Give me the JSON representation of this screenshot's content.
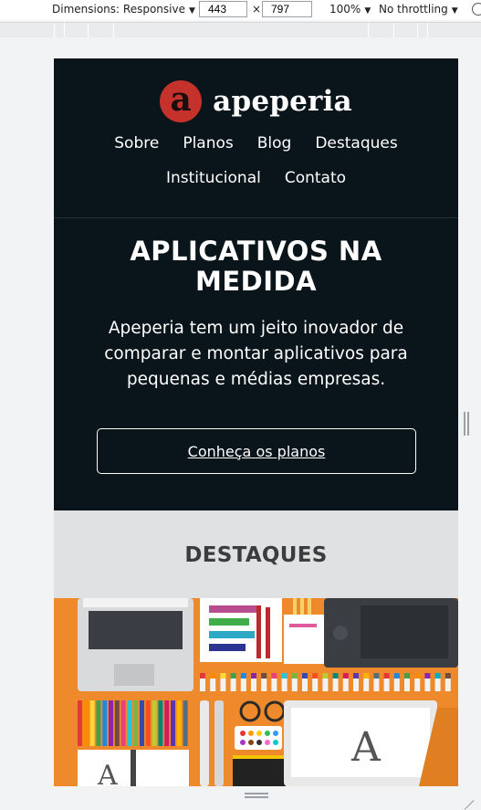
{
  "devtools": {
    "dimensions_label": "Dimensions: Responsive",
    "width_value": "443",
    "times_sign": "×",
    "height_value": "797",
    "zoom": "100%",
    "throttling": "No throttling"
  },
  "site": {
    "logo_letter": "a",
    "brand_name": "apeperia",
    "nav": [
      "Sobre",
      "Planos",
      "Blog",
      "Destaques",
      "Institucional",
      "Contato"
    ],
    "hero_title": "APLICATIVOS NA MEDIDA",
    "hero_text": "Apeperia tem um jeito inovador de comparar e montar aplicativos para pequenas e médias empresas.",
    "cta_label": "Conheça os planos",
    "section_title": "DESTAQUES"
  },
  "colors": {
    "header_bg": "#0a151b",
    "logo_red": "#c5322c",
    "section_gray": "#dfe1e3",
    "illustration_orange": "#ef8a2c"
  }
}
